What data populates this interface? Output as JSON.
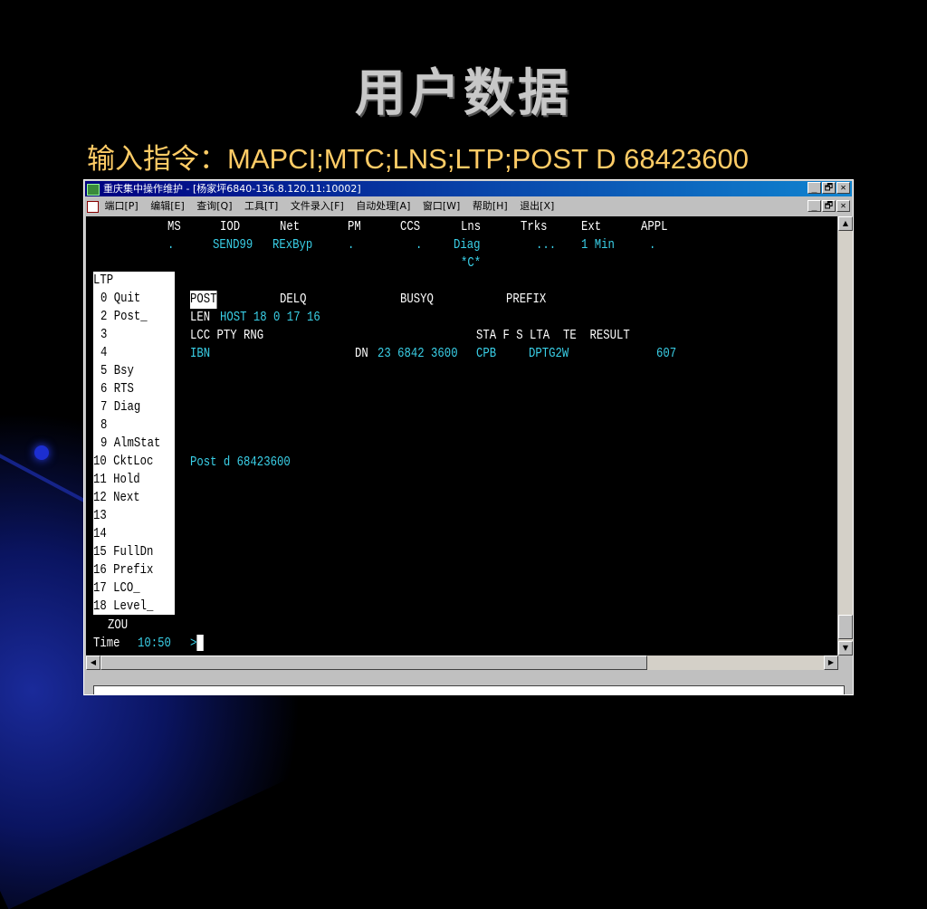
{
  "slide": {
    "title": "用户数据",
    "subtitle": "输入指令：MAPCI;MTC;LNS;LTP;POST D  68423600"
  },
  "window": {
    "title": "重庆集中操作维护 - [杨家坪6840-136.8.120.11:10002]",
    "min_label": "_",
    "restore_label": "🗗",
    "close_label": "✕",
    "menu": [
      "端口[P]",
      "编辑[E]",
      "查询[Q]",
      "工具[T]",
      "文件录入[F]",
      "自动处理[A]",
      "窗口[W]",
      "帮助[H]",
      "退出[X]"
    ]
  },
  "terminal": {
    "status_headers": {
      "ms": "MS",
      "iod": "IOD",
      "net": "Net",
      "pm": "PM",
      "ccs": "CCS",
      "lns": "Lns",
      "trks": "Trks",
      "ext": "Ext",
      "appl": "APPL"
    },
    "status_values": {
      "ms": ".",
      "iod": "SEND99",
      "net": "RExByp",
      "pm": ".",
      "ccs": ".",
      "lns": "Diag",
      "trks": "...",
      "ext": "1 Min",
      "appl": "."
    },
    "lns_alarm": "*C*",
    "menu_title": "LTP",
    "menu_items": [
      "0 Quit",
      "2 Post_",
      "3",
      "4",
      "5 Bsy",
      "6 RTS",
      "7 Diag",
      "8",
      "9 AlmStat",
      "10 CktLoc",
      "11 Hold",
      "12 Next",
      "13",
      "14",
      "15 FullDn",
      "16 Prefix",
      "17 LCO_",
      "18 Level_"
    ],
    "cols": {
      "post": "POST",
      "delq": "DELQ",
      "busyq": "BUSYQ",
      "prefix": "PREFIX"
    },
    "len_label": "LEN",
    "len_value": "HOST 18 0 17 16",
    "lcc_header": "LCC PTY RNG",
    "sta_header": "STA F S LTA  TE  RESULT",
    "lcc_value": "IBN",
    "dn_label": "DN",
    "dn_value": "23 6842 3600",
    "sta_value": "CPB",
    "lta_value": "DPTG2W",
    "result_value": "607",
    "echo": "Post d 68423600",
    "user": "ZOU",
    "time_label": "Time",
    "time_value": "10:50",
    "prompt": ">"
  },
  "colors": {
    "terminal_cyan": "#3ad0e8",
    "subtitle": "#ffcc66",
    "title": "#c8c8c8"
  }
}
